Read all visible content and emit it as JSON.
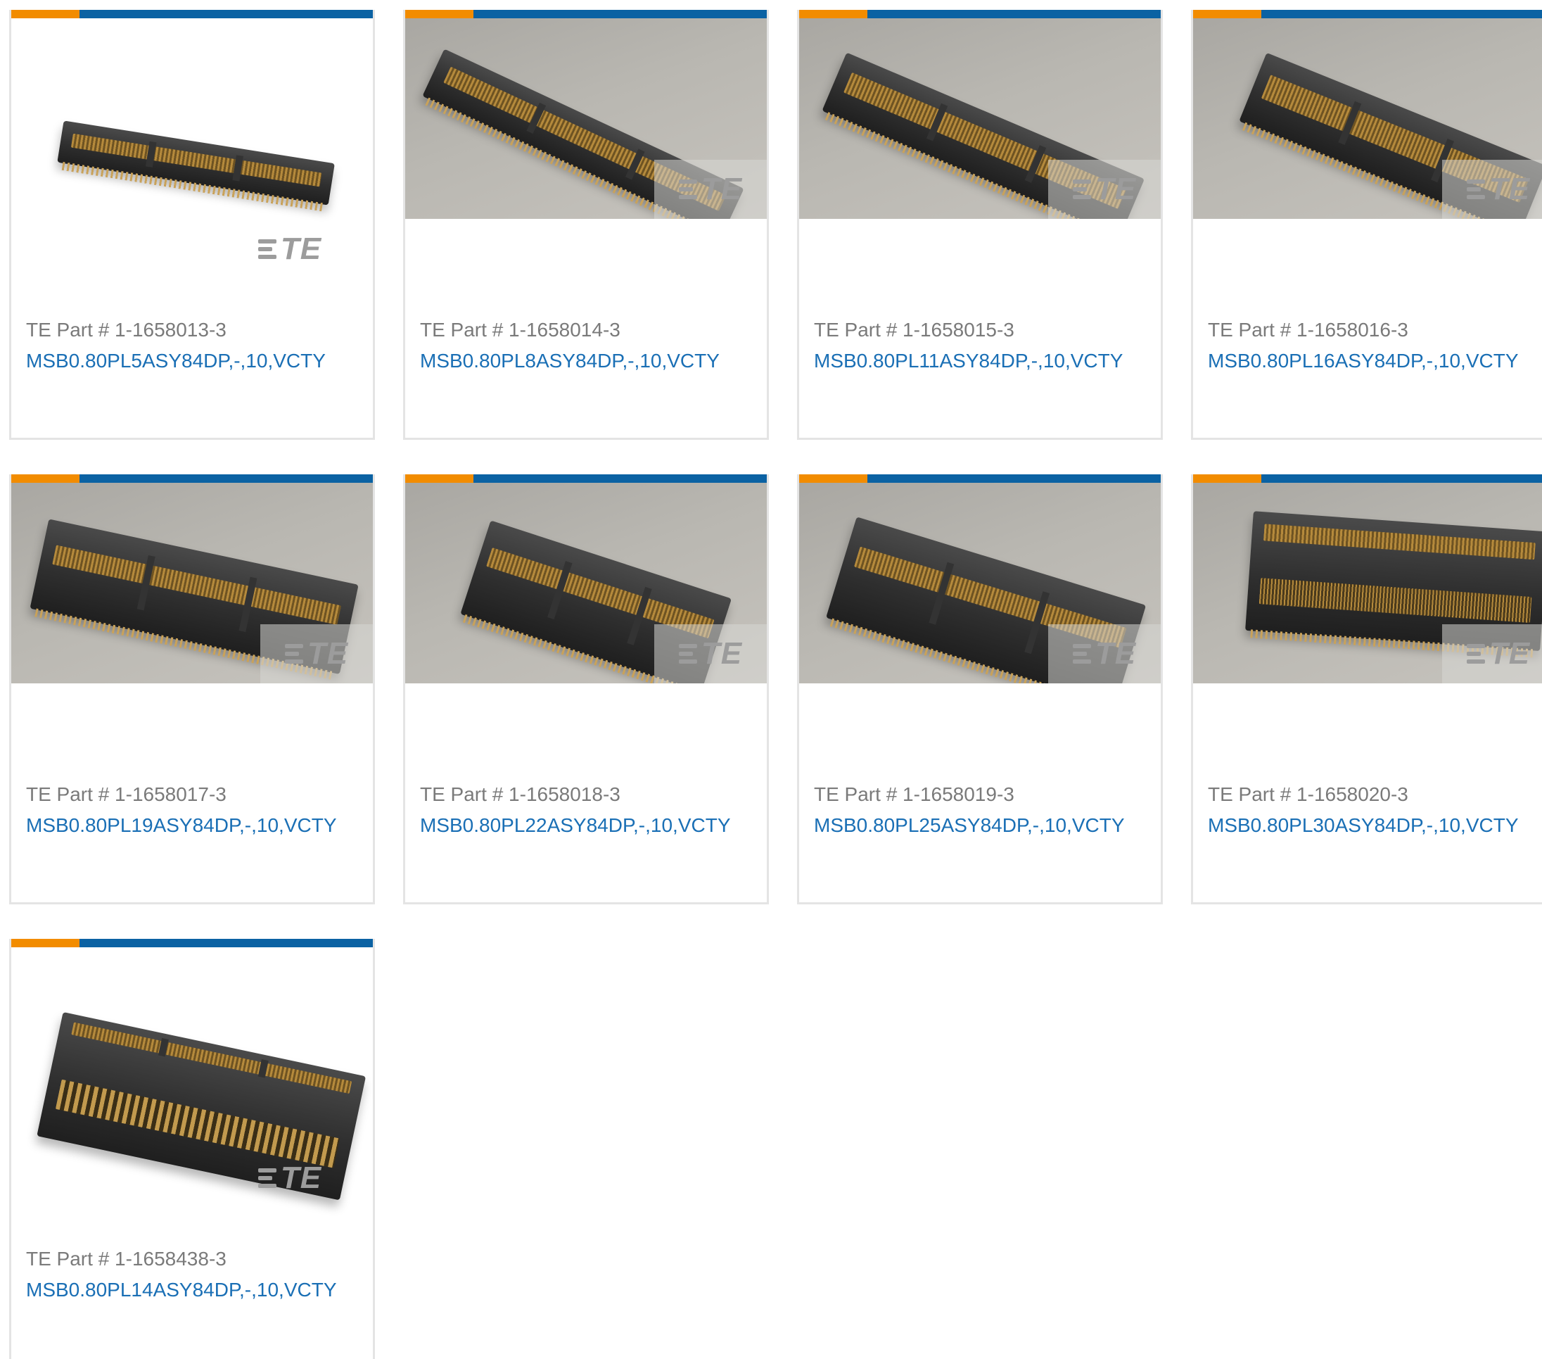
{
  "colors": {
    "accent_orange": "#f28c00",
    "accent_blue": "#0b62a3",
    "link": "#1a6fb5",
    "part_text": "#7a7a7a",
    "card_border": "#e4e4e4"
  },
  "part_prefix": "TE Part #",
  "watermark_icon": "te-logo-icon",
  "products": [
    {
      "part_number": "1-1658013-3",
      "description": "MSB0.80PL5ASY84DP,-,10,VCTY",
      "photo_style": "studio"
    },
    {
      "part_number": "1-1658014-3",
      "description": "MSB0.80PL8ASY84DP,-,10,VCTY",
      "photo_style": "gray"
    },
    {
      "part_number": "1-1658015-3",
      "description": "MSB0.80PL11ASY84DP,-,10,VCTY",
      "photo_style": "gray"
    },
    {
      "part_number": "1-1658016-3",
      "description": "MSB0.80PL16ASY84DP,-,10,VCTY",
      "photo_style": "gray"
    },
    {
      "part_number": "1-1658017-3",
      "description": "MSB0.80PL19ASY84DP,-,10,VCTY",
      "photo_style": "gray"
    },
    {
      "part_number": "1-1658018-3",
      "description": "MSB0.80PL22ASY84DP,-,10,VCTY",
      "photo_style": "gray"
    },
    {
      "part_number": "1-1658019-3",
      "description": "MSB0.80PL25ASY84DP,-,10,VCTY",
      "photo_style": "gray"
    },
    {
      "part_number": "1-1658020-3",
      "description": "MSB0.80PL30ASY84DP,-,10,VCTY",
      "photo_style": "gray"
    },
    {
      "part_number": "1-1658438-3",
      "description": "MSB0.80PL14ASY84DP,-,10,VCTY",
      "photo_style": "studio"
    }
  ]
}
